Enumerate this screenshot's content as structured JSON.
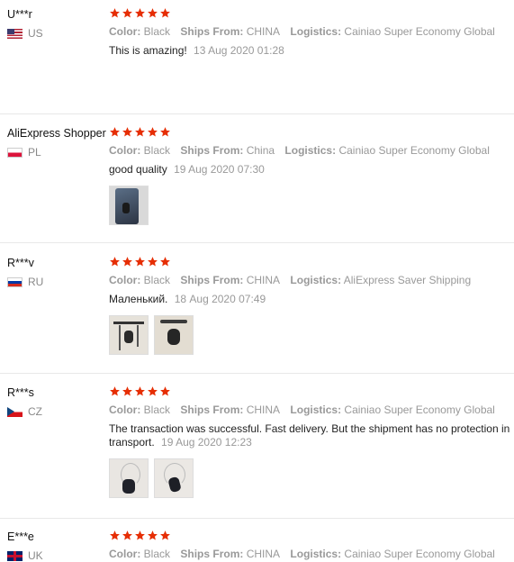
{
  "colors": {
    "star": "#e62e04",
    "text": "#222222",
    "muted": "#999999"
  },
  "reviews": [
    {
      "user": "U***r",
      "country": "US",
      "flag": "flag-us-icon",
      "stars": 5,
      "color_label": "Color:",
      "color_value": "Black",
      "ships_label": "Ships From:",
      "ships_value": "CHINA",
      "logistics_label": "Logistics:",
      "logistics_value": "Cainiao Super Economy Global",
      "text": "This is amazing!",
      "date": "13 Aug 2020 01:28"
    },
    {
      "user": "AliExpress Shopper",
      "country": "PL",
      "flag": "flag-pl-icon",
      "stars": 5,
      "color_label": "Color:",
      "color_value": "Black",
      "ships_label": "Ships From:",
      "ships_value": "China",
      "logistics_label": "Logistics:",
      "logistics_value": "Cainiao Super Economy Global",
      "text": "good quality",
      "date": "19 Aug 2020 07:30"
    },
    {
      "user": "R***v",
      "country": "RU",
      "flag": "flag-ru-icon",
      "stars": 5,
      "color_label": "Color:",
      "color_value": "Black",
      "ships_label": "Ships From:",
      "ships_value": "CHINA",
      "logistics_label": "Logistics:",
      "logistics_value": "AliExpress Saver Shipping",
      "text": "Маленький.",
      "date": "18 Aug 2020 07:49"
    },
    {
      "user": "R***s",
      "country": "CZ",
      "flag": "flag-cz-icon",
      "stars": 5,
      "color_label": "Color:",
      "color_value": "Black",
      "ships_label": "Ships From:",
      "ships_value": "CHINA",
      "logistics_label": "Logistics:",
      "logistics_value": "Cainiao Super Economy Global",
      "text": "The transaction was successful. Fast delivery. But the shipment has no protection in transport.",
      "date": "19 Aug 2020 12:23"
    },
    {
      "user": "E***e",
      "country": "UK",
      "flag": "flag-uk-icon",
      "stars": 5,
      "color_label": "Color:",
      "color_value": "Black",
      "ships_label": "Ships From:",
      "ships_value": "CHINA",
      "logistics_label": "Logistics:",
      "logistics_value": "Cainiao Super Economy Global"
    }
  ]
}
